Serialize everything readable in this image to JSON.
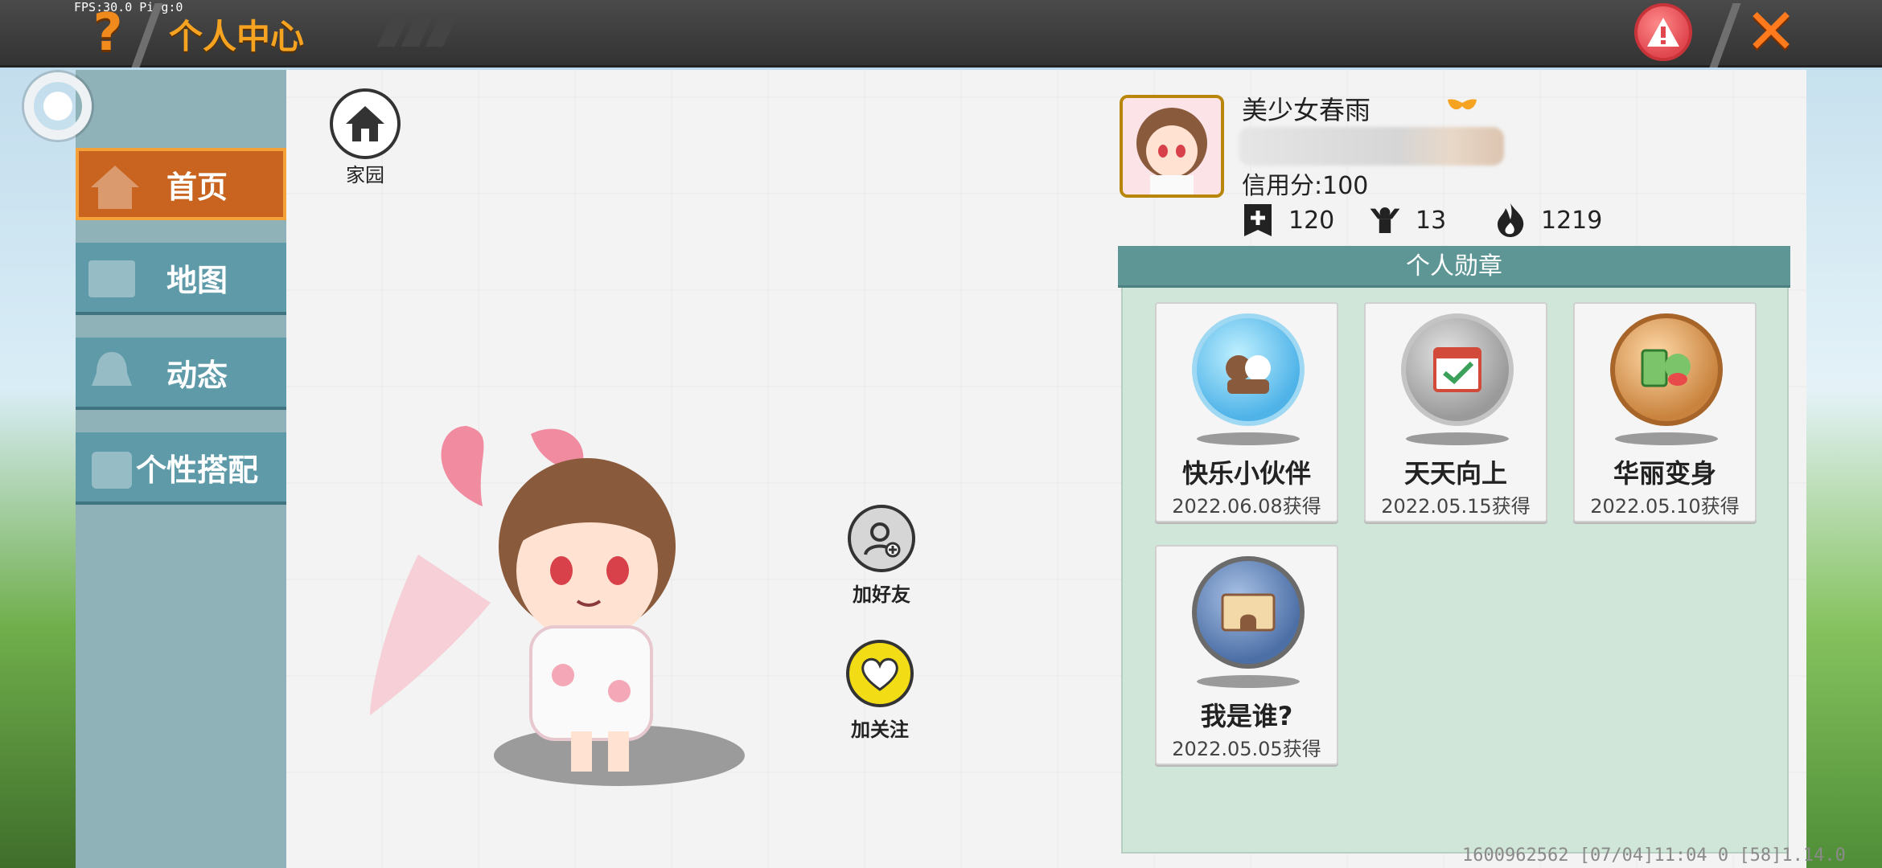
{
  "status_overlay": "FPS:30.0  Ping:0",
  "header": {
    "title": "个人中心"
  },
  "nav": {
    "items": [
      {
        "label": "首页",
        "active": true
      },
      {
        "label": "地图",
        "active": false
      },
      {
        "label": "动态",
        "active": false
      },
      {
        "label": "个性搭配",
        "active": false
      }
    ]
  },
  "home": {
    "label": "家园"
  },
  "actions": {
    "add_friend": "加好友",
    "follow": "加关注"
  },
  "profile": {
    "username": "美少女春雨",
    "credit": "信用分:100",
    "stats": [
      {
        "icon": "plus-badge-icon",
        "value": "120"
      },
      {
        "icon": "fan-icon",
        "value": "13"
      },
      {
        "icon": "fire-icon",
        "value": "1219"
      }
    ]
  },
  "medals": {
    "header": "个人勋章",
    "items": [
      {
        "name": "快乐小伙伴",
        "date": "2022.06.08获得",
        "color": "#4fb3e8"
      },
      {
        "name": "天天向上",
        "date": "2022.05.15获得",
        "color": "#9a9a9a"
      },
      {
        "name": "华丽变身",
        "date": "2022.05.10获得",
        "color": "#c9833e"
      },
      {
        "name": "我是谁?",
        "date": "2022.05.05获得",
        "color": "#4c6fa6"
      }
    ]
  },
  "footer": {
    "text": "1600962562    [07/04]11:04 0  [58]1.14.0"
  },
  "colors": {
    "accent": "#f5a321",
    "nav_active": "#c8641f",
    "nav_default": "#5e9aa8",
    "medal_header": "#5e9696"
  }
}
